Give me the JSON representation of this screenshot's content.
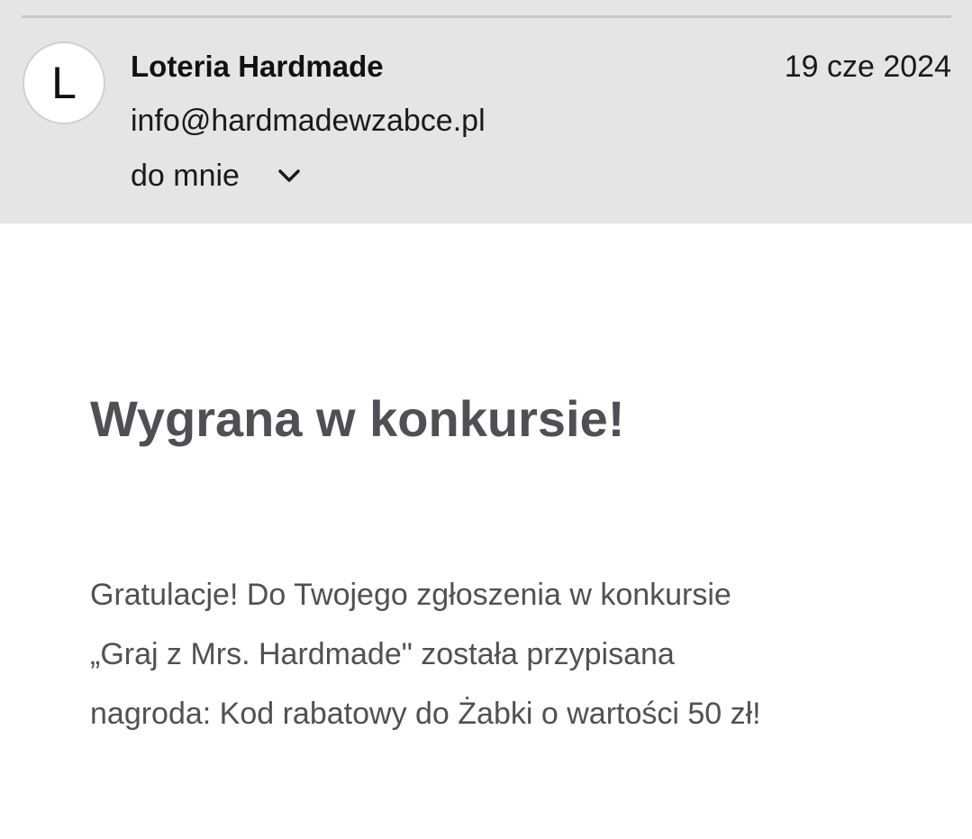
{
  "email_header": {
    "avatar_letter": "L",
    "sender_name": "Loteria Hardmade",
    "sender_email": "info@hardmadewzabce.pl",
    "recipient_label": "do mnie",
    "date": "19 cze 2024",
    "expand_icon": "chevron-down-icon"
  },
  "email_body": {
    "headline": "Wygrana w konkursie!",
    "paragraph_lines": [
      "Gratulacje! Do Twojego zgłoszenia w konkursie",
      "„Graj z Mrs. Hardmade\" została przypisana",
      "nagroda: Kod rabatowy do Żabki o wartości 50 zł!"
    ]
  },
  "colors": {
    "header_background": "#e5e5e5",
    "headline_text": "#4f4f55",
    "body_text": "#505055"
  }
}
